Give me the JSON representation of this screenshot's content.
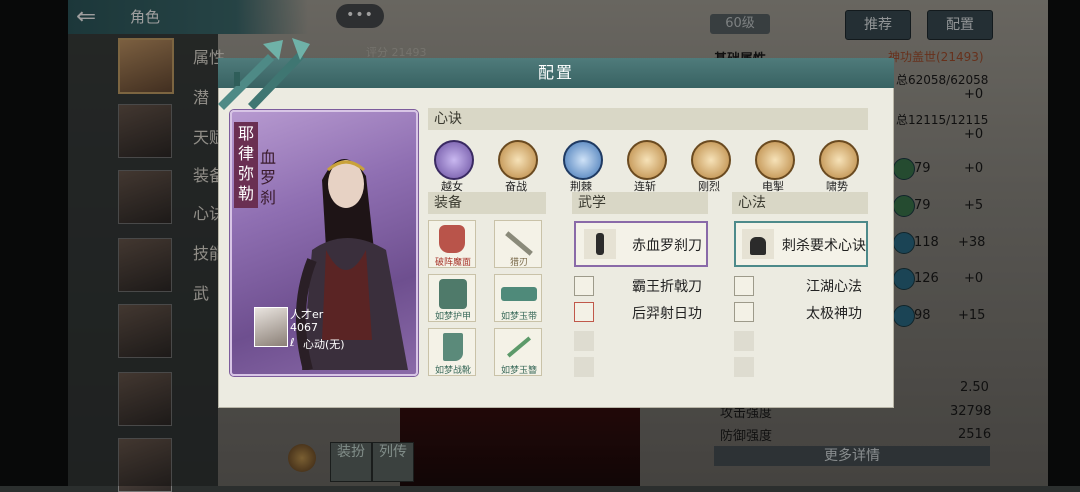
{
  "background": {
    "back_glyph": "⇐",
    "title": "角色",
    "chat_dots": "•••",
    "side_tabs": [
      "属性",
      "潜",
      "天赋",
      "装备",
      "心诀",
      "技能",
      "武"
    ],
    "level": "60级",
    "buttons": {
      "recommend": "推荐",
      "config": "配置"
    },
    "score": "评分  21493",
    "right_panel": {
      "base_attr": "基础属性",
      "title_text": "神功盖世(21493)",
      "rows": [
        {
          "total": "总62058/62058",
          "delta": "+0"
        },
        {
          "total": "总12115/12115",
          "delta": "+0"
        }
      ],
      "stat_rows": [
        {
          "value": "79",
          "delta": "+0"
        },
        {
          "value": "79",
          "delta": "+5"
        },
        {
          "value": "118",
          "delta": "+38"
        },
        {
          "value": "126",
          "delta": "+0"
        },
        {
          "value": "98",
          "delta": "+15"
        }
      ],
      "bottom_stats": [
        {
          "label": "",
          "value": "2.50"
        },
        {
          "label": "攻击强度",
          "value": "32798"
        },
        {
          "label": "防御强度",
          "value": "2516"
        }
      ],
      "more": "更多详情"
    },
    "bottom_tabs": [
      "装扮",
      "列传"
    ]
  },
  "modal": {
    "title": "配置",
    "card": {
      "name": "耶律弥勒",
      "title": "血罗刹",
      "player_name": "人才er",
      "power": "4067",
      "heart": "心动(无)"
    },
    "xinjue": {
      "header": "心诀",
      "skills": [
        {
          "label": "越女",
          "color": "#6a4fa0"
        },
        {
          "label": "奋战",
          "color": "#b8843e"
        },
        {
          "label": "荆棘",
          "color": "#3f74b4"
        },
        {
          "label": "连斩",
          "color": "#b8843e"
        },
        {
          "label": "刚烈",
          "color": "#b8843e"
        },
        {
          "label": "电掣",
          "color": "#b8843e"
        },
        {
          "label": "啸势",
          "color": "#b8843e"
        }
      ]
    },
    "equipment": {
      "header": "装备",
      "items": [
        {
          "label": "破阵魔面",
          "color": "#b9544a"
        },
        {
          "label": "猎刃",
          "color": "#b8a37a"
        },
        {
          "label": "如梦护甲",
          "color": "#4f7a6a"
        },
        {
          "label": "如梦玉带",
          "color": "#4f8a7a"
        },
        {
          "label": "如梦战靴",
          "color": "#5b8a7a"
        },
        {
          "label": "如梦玉簪",
          "color": "#5c9a6a"
        }
      ]
    },
    "martial": {
      "header": "武学",
      "main": "赤血罗刹刀",
      "subs": [
        "霸王折戟刀",
        "后羿射日功"
      ]
    },
    "mind": {
      "header": "心法",
      "main": "刺杀要术心诀",
      "subs": [
        "江湖心法",
        "太极神功"
      ]
    }
  }
}
